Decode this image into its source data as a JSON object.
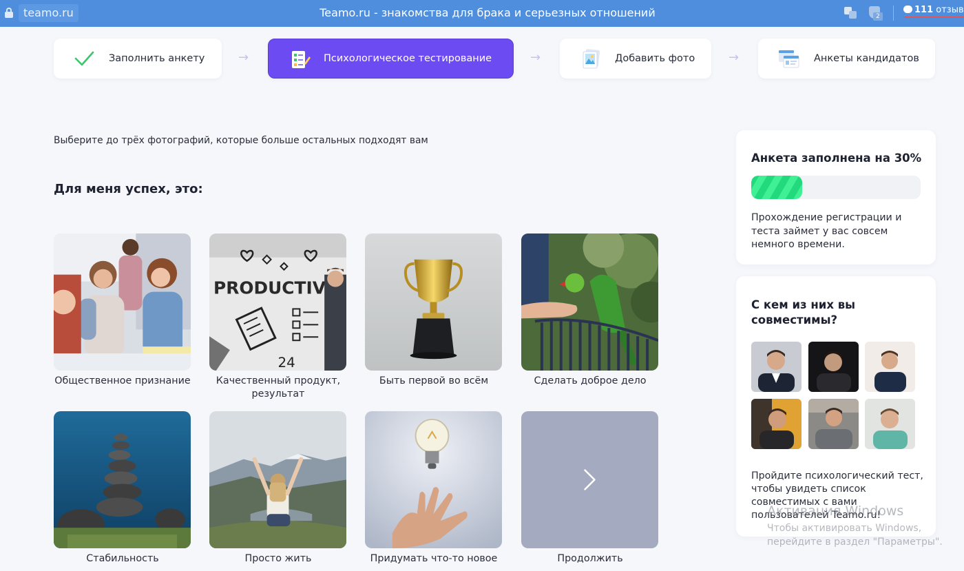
{
  "browser": {
    "url": "teamo.ru",
    "title": "Teamo.ru - знакомства для брака и серьезных отношений",
    "shield_badge": "2",
    "reviews_count": "111",
    "reviews_label": "отзыво"
  },
  "steps": [
    {
      "label": "Заполнить анкету",
      "icon": "checkmark-icon",
      "state": "done"
    },
    {
      "label": "Психологическое тестирование",
      "icon": "test-checklist-icon",
      "state": "active"
    },
    {
      "label": "Добавить фото",
      "icon": "photo-icon",
      "state": "pending"
    },
    {
      "label": "Анкеты кандидатов",
      "icon": "profiles-icon",
      "state": "pending"
    }
  ],
  "colors": {
    "accent": "#6c4cf2",
    "progress": "#22d97e",
    "browser_bar": "#4f8edd",
    "next_tile": "#a4abc1"
  },
  "test": {
    "instruction": "Выберите до трёх фотографий, которые больше остальных подходят вам",
    "question": "Для меня успех, это:",
    "options": [
      {
        "caption": "Общественное признание"
      },
      {
        "caption": "Качественный продукт, результат"
      },
      {
        "caption": "Быть первой во всём"
      },
      {
        "caption": "Сделать доброе дело"
      },
      {
        "caption": "Стабильность"
      },
      {
        "caption": "Просто жить"
      },
      {
        "caption": "Придумать что-то новое"
      },
      {
        "caption": "Продолжить"
      }
    ],
    "poster_text": "PRODUCTIVITY",
    "poster_number": "24"
  },
  "progress_card": {
    "title": "Анкета заполнена на 30%",
    "percent": 30,
    "text": "Прохождение регистрации и теста займет у вас совсем немного времени."
  },
  "compat_card": {
    "title": "С кем из них вы совместимы?",
    "text": "Пройдите психологический тест, чтобы увидеть список совместимых с вами пользователей Teamo.ru!"
  },
  "watermark": {
    "title": "Активация Windows",
    "text": "Чтобы активировать Windows, перейдите в раздел \"Параметры\"."
  }
}
